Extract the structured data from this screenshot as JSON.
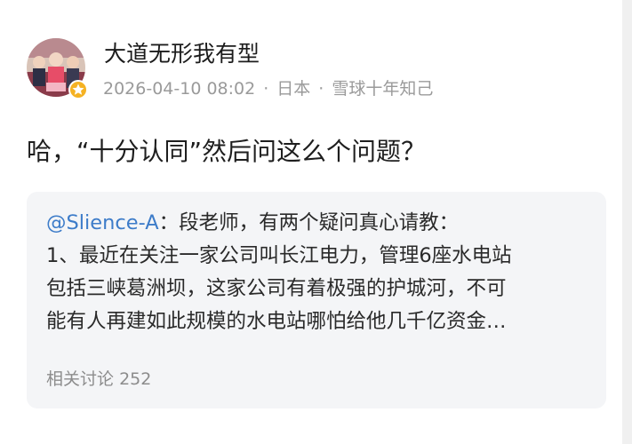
{
  "post": {
    "author": {
      "name": "大道无形我有型",
      "avatar_icon": "avatar-photo-icon",
      "badge_icon": "verified-badge-icon",
      "badge_color": "#f5b223"
    },
    "meta": {
      "timestamp": "2026-04-10 08:02",
      "separator": "·",
      "location": "日本",
      "source": "雪球十年知己"
    },
    "content": "哈，“十分认同”然后问这么个问题？",
    "quote": {
      "mention": "@Slience-A",
      "mention_color": "#3d7cc9",
      "first_line_rest": "：段老师，有两个疑问真心请教：",
      "lines": [
        "1、最近在关注一家公司叫长江电力，管理6座水电站",
        "包括三峡葛洲坝，这家公司有着极强的护城河，不可",
        "能有人再建如此规模的水电站哪怕给他几千亿资金…"
      ],
      "related_label": "相关讨论",
      "related_count": "252"
    }
  }
}
